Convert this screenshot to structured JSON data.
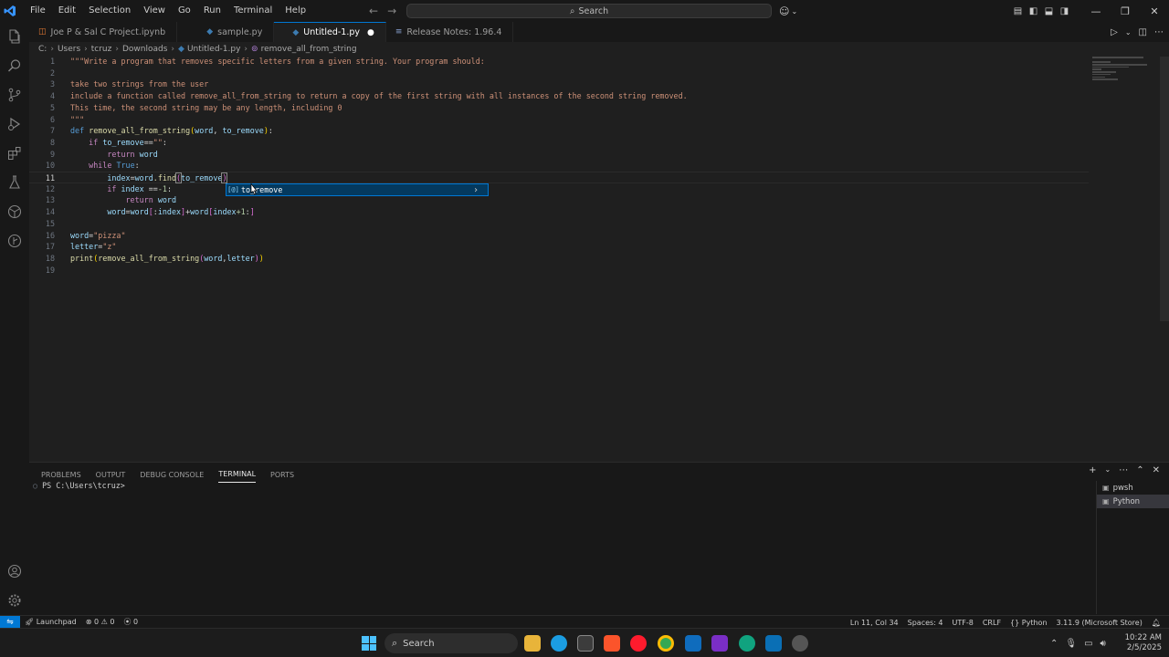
{
  "titlebar": {
    "menu": [
      "File",
      "Edit",
      "Selection",
      "View",
      "Go",
      "Run",
      "Terminal",
      "Help"
    ],
    "search_label": "Search"
  },
  "tabs": [
    {
      "label": "Joe P & Sal C Project.ipynb",
      "icon": "notebook-icon"
    },
    {
      "label": "sample.py",
      "icon": "python-file-icon"
    },
    {
      "label": "Untitled-1.py",
      "icon": "python-file-icon",
      "active": true,
      "unsaved": true
    },
    {
      "label": "Release Notes: 1.96.4",
      "icon": "release-notes-icon"
    }
  ],
  "breadcrumb": {
    "parts": [
      "C:",
      "Users",
      "tcruz",
      "Downloads",
      "Untitled-1.py",
      "remove_all_from_string"
    ]
  },
  "editor": {
    "line_numbers": [
      "1",
      "2",
      "3",
      "4",
      "5",
      "6",
      "7",
      "8",
      "9",
      "10",
      "11",
      "12",
      "13",
      "14",
      "15",
      "16",
      "17",
      "18",
      "19"
    ],
    "current_line": 11,
    "t": {
      "l1": "\"\"\"Write a program that removes specific letters from a given string. Your program should:",
      "l3": "take two strings from the user",
      "l4": "include a function called remove_all_from_string to return a copy of the first string with all instances of the second string removed.",
      "l5": "This time, the second string may be any length, including 0",
      "l6": "\"\"\"",
      "def": "def",
      "fn_name": "remove_all_from_string",
      "lp": "(",
      "rp": ")",
      "word": "word",
      "comma": ", ",
      "to_remove": "to_remove",
      "colon": ":",
      "if": "if",
      "eqeq_str": "==",
      "empty_str": "\"\"",
      "return": "return",
      "while": "while",
      "true": "True",
      "index": "index",
      "eq": "=",
      "dot_find": ".find",
      "eqeq_neg": " ==",
      "neg1": "-1",
      "lb": "[",
      "rb": "]",
      "slice_colon": ":",
      "plus": "+",
      "plus1": "+1",
      "pizza": "\"pizza\"",
      "letter": "letter",
      "z": "\"z\"",
      "print": "print",
      "comma_nospace": ","
    }
  },
  "suggest": {
    "label": "to_remove",
    "kind_icon": "[@]"
  },
  "panel": {
    "tabs": [
      "PROBLEMS",
      "OUTPUT",
      "DEBUG CONSOLE",
      "TERMINAL",
      "PORTS"
    ],
    "active_tab": "TERMINAL",
    "terminal_prompt": "PS C:\\Users\\tcruz>",
    "terminals": [
      "pwsh",
      "Python"
    ]
  },
  "statusbar": {
    "launchpad": "Launchpad",
    "errors": "0",
    "warnings": "0",
    "ports": "0",
    "position": "Ln 11, Col 34",
    "spaces": "Spaces: 4",
    "encoding": "UTF-8",
    "eol": "CRLF",
    "language": "Python",
    "interpreter": "3.11.9 (Microsoft Store)"
  },
  "taskbar": {
    "search_label": "Search",
    "time": "10:22 AM",
    "date": "2/5/2025"
  },
  "colors": {
    "accent": "#0078d4",
    "editor_bg": "#1f1f1f",
    "string": "#ce9178",
    "keyword": "#c586c0"
  }
}
